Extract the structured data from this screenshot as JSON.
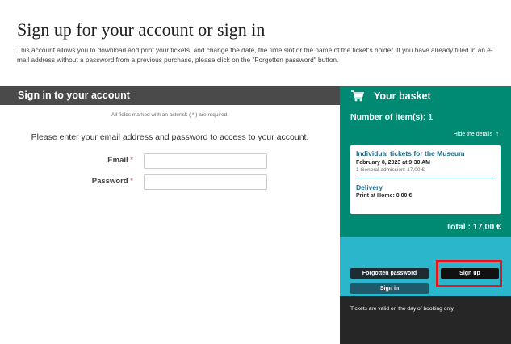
{
  "page": {
    "title": "Sign up for your account or sign in",
    "intro": "This account allows you to download and print your tickets, and change the date, the time slot or the name of the ticket's holder. If you have already filled in an e-mail address without a password from a previous purchase, please click on the \"Forgotten password\" button."
  },
  "signin": {
    "header": "Sign in to your account",
    "required_note": "All fields marked with an asterisk ( * ) are required.",
    "prompt": "Please enter your email address and password to access to your account.",
    "email_label": "Email",
    "password_label": "Password",
    "asterisk": "*",
    "email_value": "",
    "password_value": ""
  },
  "basket": {
    "title": "Your basket",
    "icon": "cart-icon",
    "item_count": "Number of item(s): 1",
    "hide_details": "Hide the details",
    "hide_arrow": "↑",
    "ticket": {
      "name": "Individual tickets for the Museum",
      "date": "February 8, 2023 at 9:30 AM",
      "admission": "1 General admission: 17,00 €"
    },
    "delivery": {
      "title": "Delivery",
      "detail": "Print at Home: 0,00 €"
    },
    "total": "Total : 17,00 €",
    "buttons": {
      "forgotten_password": "Forgotten password",
      "sign_up": "Sign up",
      "sign_in": "Sign in"
    },
    "validity": "Tickets are valid on the day of booking only."
  },
  "colors": {
    "basket_green": "#008a73",
    "basket_teal": "#2bb6cc",
    "highlight_red": "#e8141c",
    "header_gray": "#4a4a4a"
  }
}
